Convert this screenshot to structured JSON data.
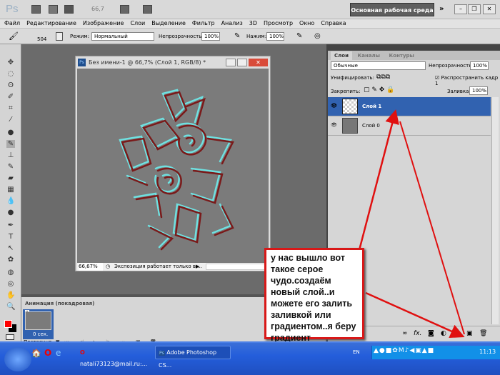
{
  "app": {
    "logo": "Ps",
    "zoom": "66,7",
    "workspace": "Основная рабочая среда",
    "more": "»"
  },
  "menu": [
    "Файл",
    "Редактирование",
    "Изображение",
    "Слои",
    "Выделение",
    "Фильтр",
    "Анализ",
    "3D",
    "Просмотр",
    "Окно",
    "Справка"
  ],
  "options": {
    "brush_size": "504",
    "mode_label": "Режим:",
    "mode_value": "Нормальный",
    "opacity_label": "Непрозрачность:",
    "opacity_value": "100%",
    "flow_label": "Нажим:",
    "flow_value": "100%"
  },
  "document": {
    "title": "Без имени-1 @ 66,7% (Слой 1, RGB/8) *",
    "zoom": "66,67%",
    "status": "Экспозиция работает только в ..."
  },
  "animation": {
    "tab": "Анимация (покадровая)",
    "frame_number": "1",
    "frame_delay": "0 сек.",
    "loop": "Постоянно"
  },
  "layers": {
    "tabs": [
      "Слои",
      "Каналы",
      "Контуры"
    ],
    "blend": "Обычные",
    "opacity_label": "Непрозрачность:",
    "opacity_value": "100%",
    "unify_label": "Унифицировать:",
    "propagate_label": "Распространить кадр 1",
    "lock_label": "Закрепить:",
    "fill_label": "Заливка:",
    "fill_value": "100%",
    "items": [
      {
        "name": "Слой 1",
        "selected": true
      },
      {
        "name": "Слой 0",
        "selected": false
      }
    ],
    "footer_fx": "fx."
  },
  "callout": "у нас вышло вот такое серое чудо.создаём новый слой..и можете его залить заливкой или градиентом..я беру градиент",
  "taskbar": {
    "email": "natali73123@mail.ru:...",
    "photoshop": "Adobe Photoshop CS...",
    "lang": "EN",
    "time": "11:13"
  },
  "colors": {
    "foreground": "#ff0000",
    "background": "#000000",
    "selection": "#3162b0",
    "arrow": "#e01010"
  }
}
